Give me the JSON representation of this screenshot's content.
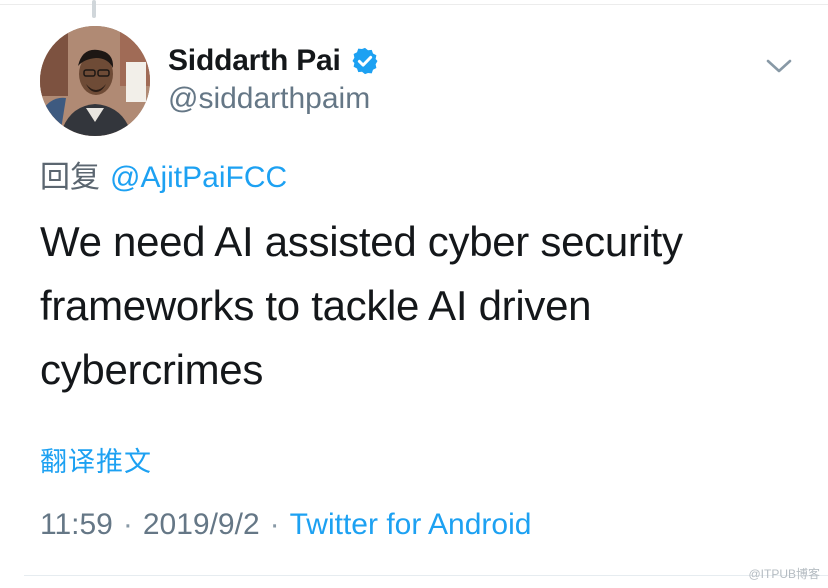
{
  "tweet": {
    "author": {
      "display_name": "Siddarth Pai",
      "handle": "@siddarthpaim",
      "verified": true,
      "avatar_icon": "profile-photo"
    },
    "reply": {
      "prefix": "回复",
      "mention": "@AjitPaiFCC"
    },
    "text": "We need AI assisted cyber security frameworks to tackle AI driven cybercrimes",
    "translate_label": "翻译推文",
    "meta": {
      "time": "11:59",
      "separator": "·",
      "date": "2019/9/2",
      "source": "Twitter for Android"
    },
    "menu_icon": "chevron-down-icon"
  },
  "watermark": "@ITPUB博客",
  "colors": {
    "accent": "#1da1f2",
    "text": "#14171a",
    "muted": "#657786"
  }
}
